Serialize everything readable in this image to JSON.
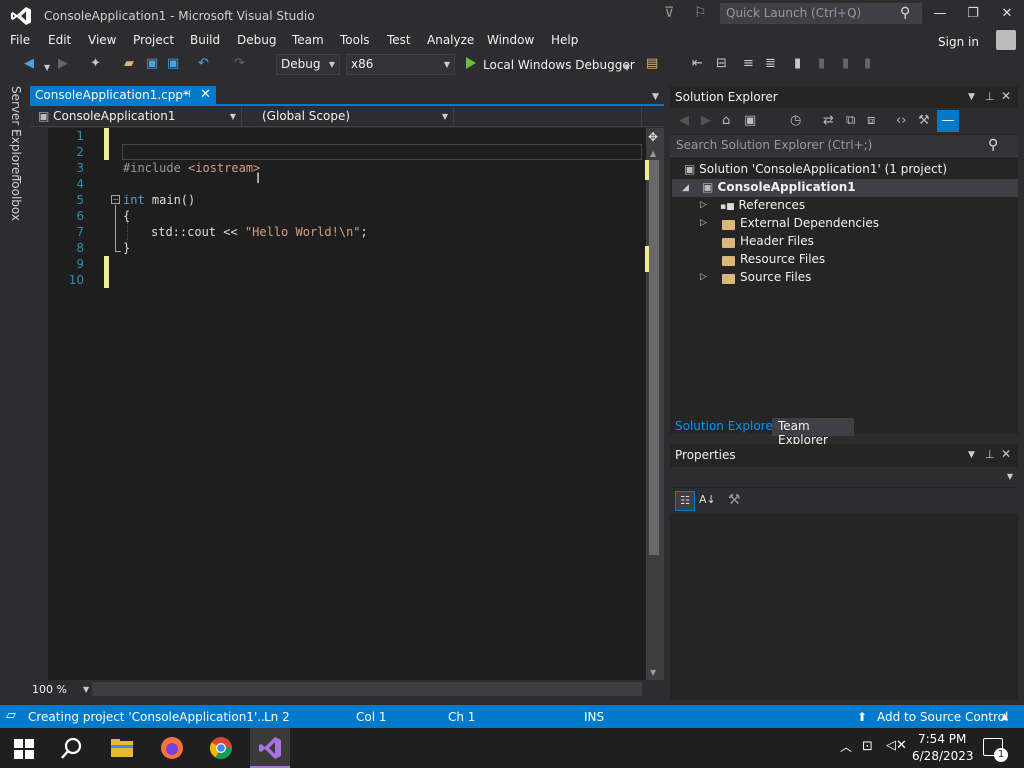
{
  "window": {
    "title": "ConsoleApplication1 - Microsoft Visual Studio",
    "quick_launch_placeholder": "Quick Launch (Ctrl+Q)"
  },
  "menu": {
    "items": [
      "File",
      "Edit",
      "View",
      "Project",
      "Build",
      "Debug",
      "Team",
      "Tools",
      "Test",
      "Analyze",
      "Window",
      "Help"
    ],
    "sign_in": "Sign in"
  },
  "toolbar": {
    "configuration": "Debug",
    "platform": "x86",
    "run_label": "Local Windows Debugger"
  },
  "left_tabs": [
    "Server Explorer",
    "Toolbox"
  ],
  "document": {
    "tab_label": "ConsoleApplication1.cpp*",
    "project_combo": "ConsoleApplication1",
    "scope_combo": "(Global Scope)",
    "zoom": "100 %"
  },
  "code": {
    "line_numbers": [
      "1",
      "2",
      "3",
      "4",
      "5",
      "6",
      "7",
      "8",
      "9",
      "10"
    ],
    "include_kw": "#include",
    "include_file": "<iostream>",
    "int_kw": "int",
    "main_sig": " main()",
    "open_brace": "{",
    "cout_stmt": "std::cout << ",
    "string_lit": "\"Hello World!\\n\"",
    "semicolon": ";",
    "close_brace": "}"
  },
  "solution_explorer": {
    "title": "Solution Explorer",
    "search_placeholder": "Search Solution Explorer (Ctrl+;)",
    "solution": "Solution 'ConsoleApplication1' (1 project)",
    "project": "ConsoleApplication1",
    "nodes": [
      "References",
      "External Dependencies",
      "Header Files",
      "Resource Files",
      "Source Files"
    ],
    "tab_se": "Solution Explorer",
    "tab_te": "Team Explorer"
  },
  "properties": {
    "title": "Properties"
  },
  "status": {
    "message": "Creating project 'ConsoleApplication1'...",
    "ln": "Ln 2",
    "col": "Col 1",
    "ch": "Ch 1",
    "mode": "INS",
    "source_control": "Add to Source Control"
  },
  "taskbar": {
    "time": "7:54 PM",
    "date": "6/28/2023",
    "notification_count": "1"
  },
  "colors": {
    "accent": "#007acc",
    "editor_bg": "#1e1e1e",
    "keyword": "#569cd6",
    "string": "#d69d85",
    "preproc": "#9b9b9b",
    "line_number": "#2b91af",
    "changed_line": "#efef91"
  }
}
